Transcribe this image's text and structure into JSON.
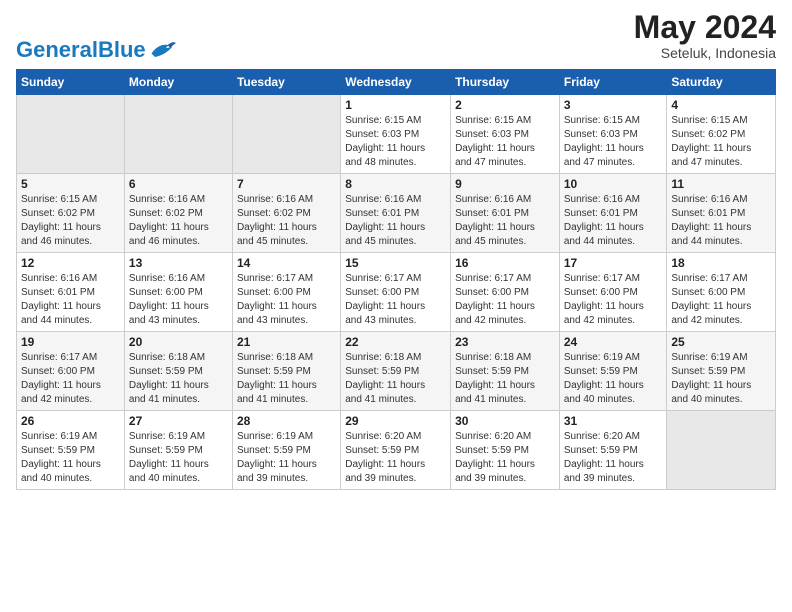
{
  "header": {
    "logo_general": "General",
    "logo_blue": "Blue",
    "month": "May 2024",
    "location": "Seteluk, Indonesia"
  },
  "weekdays": [
    "Sunday",
    "Monday",
    "Tuesday",
    "Wednesday",
    "Thursday",
    "Friday",
    "Saturday"
  ],
  "weeks": [
    [
      {
        "day": "",
        "info": ""
      },
      {
        "day": "",
        "info": ""
      },
      {
        "day": "",
        "info": ""
      },
      {
        "day": "1",
        "info": "Sunrise: 6:15 AM\nSunset: 6:03 PM\nDaylight: 11 hours\nand 48 minutes."
      },
      {
        "day": "2",
        "info": "Sunrise: 6:15 AM\nSunset: 6:03 PM\nDaylight: 11 hours\nand 47 minutes."
      },
      {
        "day": "3",
        "info": "Sunrise: 6:15 AM\nSunset: 6:03 PM\nDaylight: 11 hours\nand 47 minutes."
      },
      {
        "day": "4",
        "info": "Sunrise: 6:15 AM\nSunset: 6:02 PM\nDaylight: 11 hours\nand 47 minutes."
      }
    ],
    [
      {
        "day": "5",
        "info": "Sunrise: 6:15 AM\nSunset: 6:02 PM\nDaylight: 11 hours\nand 46 minutes."
      },
      {
        "day": "6",
        "info": "Sunrise: 6:16 AM\nSunset: 6:02 PM\nDaylight: 11 hours\nand 46 minutes."
      },
      {
        "day": "7",
        "info": "Sunrise: 6:16 AM\nSunset: 6:02 PM\nDaylight: 11 hours\nand 45 minutes."
      },
      {
        "day": "8",
        "info": "Sunrise: 6:16 AM\nSunset: 6:01 PM\nDaylight: 11 hours\nand 45 minutes."
      },
      {
        "day": "9",
        "info": "Sunrise: 6:16 AM\nSunset: 6:01 PM\nDaylight: 11 hours\nand 45 minutes."
      },
      {
        "day": "10",
        "info": "Sunrise: 6:16 AM\nSunset: 6:01 PM\nDaylight: 11 hours\nand 44 minutes."
      },
      {
        "day": "11",
        "info": "Sunrise: 6:16 AM\nSunset: 6:01 PM\nDaylight: 11 hours\nand 44 minutes."
      }
    ],
    [
      {
        "day": "12",
        "info": "Sunrise: 6:16 AM\nSunset: 6:01 PM\nDaylight: 11 hours\nand 44 minutes."
      },
      {
        "day": "13",
        "info": "Sunrise: 6:16 AM\nSunset: 6:00 PM\nDaylight: 11 hours\nand 43 minutes."
      },
      {
        "day": "14",
        "info": "Sunrise: 6:17 AM\nSunset: 6:00 PM\nDaylight: 11 hours\nand 43 minutes."
      },
      {
        "day": "15",
        "info": "Sunrise: 6:17 AM\nSunset: 6:00 PM\nDaylight: 11 hours\nand 43 minutes."
      },
      {
        "day": "16",
        "info": "Sunrise: 6:17 AM\nSunset: 6:00 PM\nDaylight: 11 hours\nand 42 minutes."
      },
      {
        "day": "17",
        "info": "Sunrise: 6:17 AM\nSunset: 6:00 PM\nDaylight: 11 hours\nand 42 minutes."
      },
      {
        "day": "18",
        "info": "Sunrise: 6:17 AM\nSunset: 6:00 PM\nDaylight: 11 hours\nand 42 minutes."
      }
    ],
    [
      {
        "day": "19",
        "info": "Sunrise: 6:17 AM\nSunset: 6:00 PM\nDaylight: 11 hours\nand 42 minutes."
      },
      {
        "day": "20",
        "info": "Sunrise: 6:18 AM\nSunset: 5:59 PM\nDaylight: 11 hours\nand 41 minutes."
      },
      {
        "day": "21",
        "info": "Sunrise: 6:18 AM\nSunset: 5:59 PM\nDaylight: 11 hours\nand 41 minutes."
      },
      {
        "day": "22",
        "info": "Sunrise: 6:18 AM\nSunset: 5:59 PM\nDaylight: 11 hours\nand 41 minutes."
      },
      {
        "day": "23",
        "info": "Sunrise: 6:18 AM\nSunset: 5:59 PM\nDaylight: 11 hours\nand 41 minutes."
      },
      {
        "day": "24",
        "info": "Sunrise: 6:19 AM\nSunset: 5:59 PM\nDaylight: 11 hours\nand 40 minutes."
      },
      {
        "day": "25",
        "info": "Sunrise: 6:19 AM\nSunset: 5:59 PM\nDaylight: 11 hours\nand 40 minutes."
      }
    ],
    [
      {
        "day": "26",
        "info": "Sunrise: 6:19 AM\nSunset: 5:59 PM\nDaylight: 11 hours\nand 40 minutes."
      },
      {
        "day": "27",
        "info": "Sunrise: 6:19 AM\nSunset: 5:59 PM\nDaylight: 11 hours\nand 40 minutes."
      },
      {
        "day": "28",
        "info": "Sunrise: 6:19 AM\nSunset: 5:59 PM\nDaylight: 11 hours\nand 39 minutes."
      },
      {
        "day": "29",
        "info": "Sunrise: 6:20 AM\nSunset: 5:59 PM\nDaylight: 11 hours\nand 39 minutes."
      },
      {
        "day": "30",
        "info": "Sunrise: 6:20 AM\nSunset: 5:59 PM\nDaylight: 11 hours\nand 39 minutes."
      },
      {
        "day": "31",
        "info": "Sunrise: 6:20 AM\nSunset: 5:59 PM\nDaylight: 11 hours\nand 39 minutes."
      },
      {
        "day": "",
        "info": ""
      }
    ]
  ]
}
